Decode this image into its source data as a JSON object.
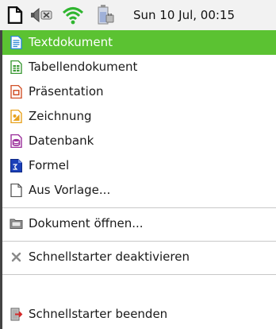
{
  "panel": {
    "clock": "Sun 10 Jul, 00:15",
    "icons": [
      "libreoffice-quickstarter-icon",
      "volume-muted-icon",
      "wifi-icon",
      "battery-plugged-icon"
    ]
  },
  "menu": {
    "items": [
      {
        "label": "Textdokument",
        "icon": "writer-icon",
        "selected": true
      },
      {
        "label": "Tabellendokument",
        "icon": "calc-icon"
      },
      {
        "label": "Präsentation",
        "icon": "impress-icon"
      },
      {
        "label": "Zeichnung",
        "icon": "draw-icon"
      },
      {
        "label": "Datenbank",
        "icon": "base-icon"
      },
      {
        "label": "Formel",
        "icon": "math-icon"
      },
      {
        "label": "Aus Vorlage...",
        "icon": "template-icon"
      },
      {
        "label": "Dokument öffnen...",
        "icon": "open-folder-icon"
      },
      {
        "label": "Schnellstarter deaktivieren",
        "icon": "close-x-icon"
      },
      {
        "label": "Schnellstarter beenden",
        "icon": "exit-icon"
      }
    ]
  },
  "colors": {
    "selection": "#5bc232",
    "writer": "#2b86d6",
    "calc": "#3d9a37",
    "impress": "#d2522a",
    "draw": "#e8a21e",
    "base": "#9b2f9b",
    "math": "#1a3fb8"
  }
}
